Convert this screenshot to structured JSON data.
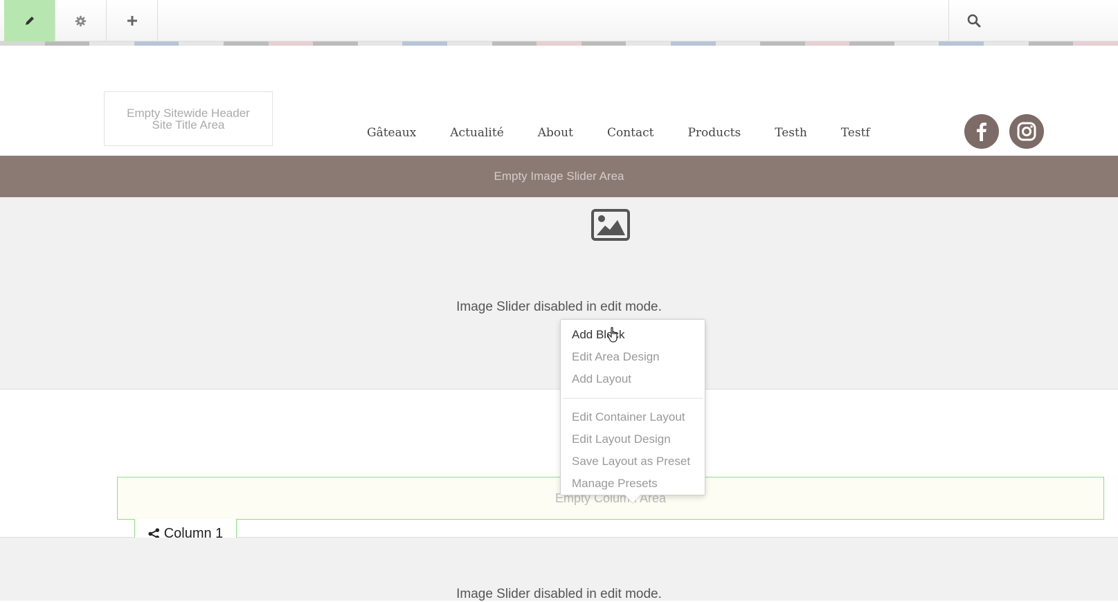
{
  "toolbar": {
    "buttons": [
      {
        "icon": "pencil-icon",
        "active": true
      },
      {
        "icon": "gear-icon",
        "active": false
      },
      {
        "icon": "plus-icon",
        "active": false
      }
    ],
    "search_icon": "search-icon",
    "stripe_colors": [
      "#d7d7d7",
      "#bababa",
      "#e6e6e6",
      "#b7c4d9",
      "#e6e6e6",
      "#bcbcbc",
      "#e8cfd3",
      "#bcbcbc",
      "#e6e6e6",
      "#b7c4d9",
      "#e6e6e6",
      "#bcbcbc",
      "#e8cfd3",
      "#bcbcbc",
      "#e6e6e6",
      "#b7c4d9",
      "#e6e6e6",
      "#bcbcbc",
      "#e8cfd3",
      "#bcbcbc",
      "#e6e6e6",
      "#b7c4d9",
      "#e6e6e6",
      "#bcbcbc",
      "#e8cfd3"
    ]
  },
  "header": {
    "site_title_line1": "Empty Sitewide Header",
    "site_title_line2": "Site Title Area",
    "nav": [
      "Gâteaux",
      "Actualité",
      "About",
      "Contact",
      "Products",
      "Testh",
      "Testf"
    ],
    "social": [
      "facebook-icon",
      "instagram-icon"
    ]
  },
  "slider": {
    "label": "Empty Image Slider Area",
    "disabled_text": "Image Slider disabled in edit mode.",
    "disabled_text_2": "Image Slider disabled in edit mode."
  },
  "column": {
    "area_label": "Empty Column Area",
    "tab_label": "Column 1"
  },
  "context_menu": {
    "group1": [
      "Add Block",
      "Edit Area Design",
      "Add Layout"
    ],
    "group2": [
      "Edit Container Layout",
      "Edit Layout Design",
      "Save Layout as Preset",
      "Manage Presets"
    ]
  },
  "colors": {
    "accent_green": "#b8e6b0",
    "slider_brown": "#8b7a74",
    "social_brown": "#7c6b66"
  }
}
